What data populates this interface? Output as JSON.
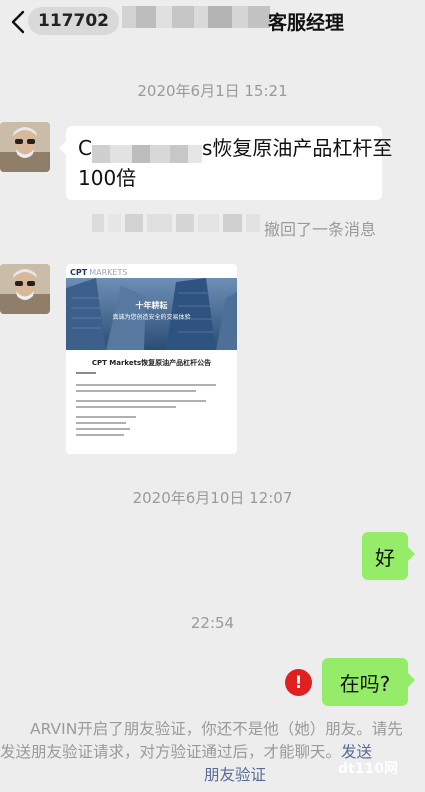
{
  "header": {
    "unread_count": "117702",
    "title": "客服经理"
  },
  "messages": {
    "time_1": "2020年6月1日 15:21",
    "msg_1_prefix": "C",
    "msg_1_suffix": "s恢复原油产品杠杆至",
    "msg_1_line2": "100倍",
    "recall_text": "撤回了一条消息",
    "time_2": "2020年6月10日 12:07",
    "msg_2": "好",
    "time_3": "22:54",
    "msg_3": "在吗?"
  },
  "document_card": {
    "brand": "CPT",
    "brand_sub": "MARKETS",
    "banner_line_1": "十年耕耘",
    "banner_line_2": "真诚为您创造安全的交易体验",
    "doc_title": "CPT Markets恢复原油产品杠杆公告"
  },
  "notice": {
    "line_1": "ARVIN开启了朋友验证，你还不是他（她）朋友。请先",
    "line_2_prefix": "发送朋友验证请求，对方验证通过后，才能聊天。",
    "line_2_link": "发送",
    "line_3_link": "朋友验证"
  },
  "watermark": "dt110网",
  "colors": {
    "background": "#ededed",
    "outgoing_bubble": "#95ec69",
    "incoming_bubble": "#ffffff",
    "link": "#576b95",
    "error": "#e02020"
  },
  "icons": {
    "back": "chevron-left-icon",
    "error": "exclamation-circle-icon"
  }
}
